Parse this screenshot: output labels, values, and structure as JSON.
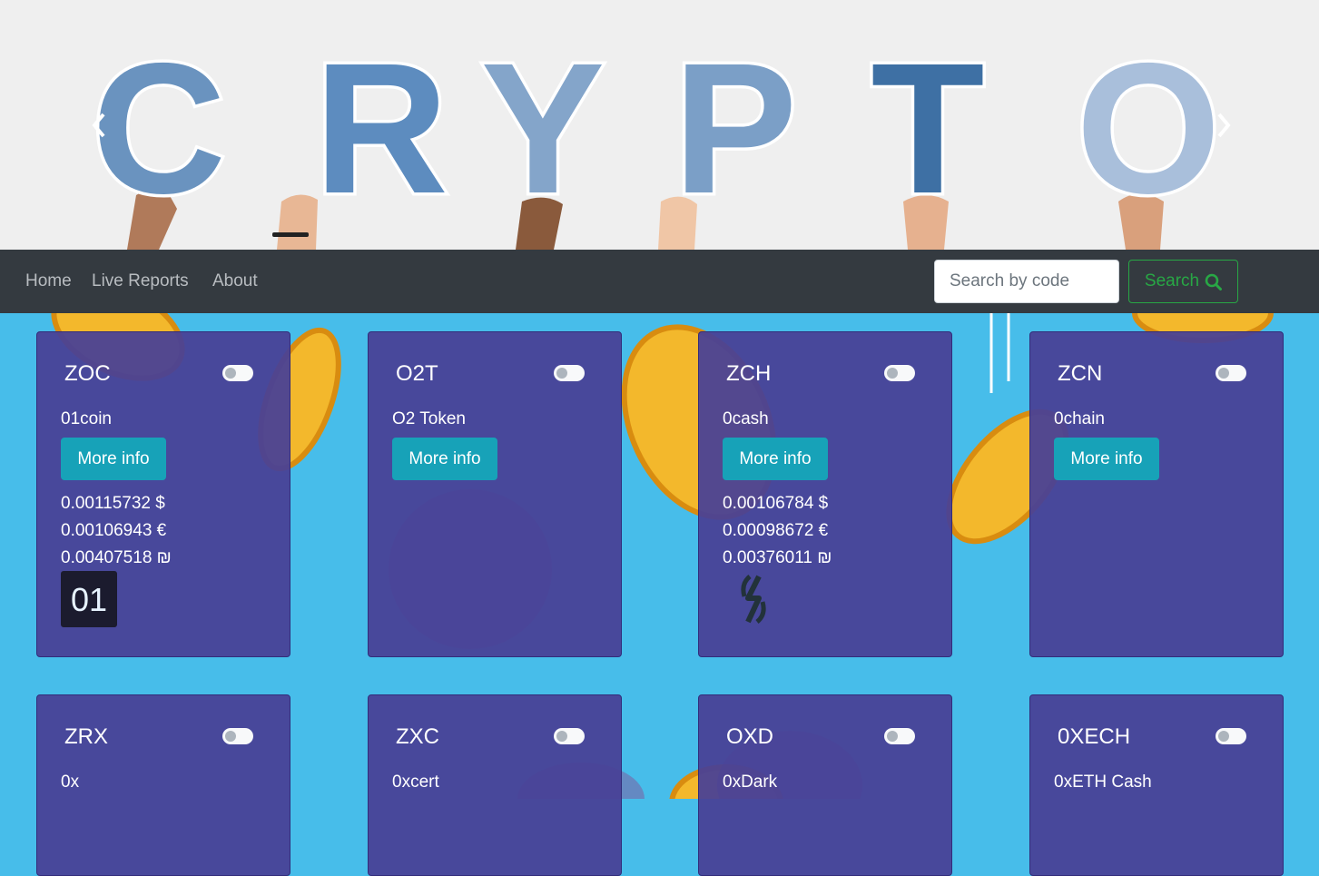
{
  "hero": {
    "word": "CRYPTO",
    "letters": [
      "C",
      "R",
      "Y",
      "P",
      "T",
      "O"
    ],
    "letter_colors": [
      "#6a93bf",
      "#5d8cbf",
      "#84a5ca",
      "#7b9fc7",
      "#3e70a4",
      "#a9bfdb"
    ],
    "prev_icon": "chevron-left-icon",
    "next_icon": "chevron-right-icon"
  },
  "nav": {
    "links": [
      "Home",
      "Live Reports",
      "About"
    ],
    "search_placeholder": "Search by code",
    "search_label": "Search",
    "search_icon": "magnifier-icon"
  },
  "colors": {
    "page_bg": "#47bdea",
    "navbar": "#343a40",
    "card_bg": "#484196",
    "info_button": "#17a2b8",
    "search_button": "#28a745",
    "coin": "#f3b82c"
  },
  "cards": [
    {
      "code": "ZOC",
      "name": "01coin",
      "more": "More info",
      "usd": "0.00115732 $",
      "eur": "0.00106943 €",
      "ils": "0.00407518 ₪",
      "logo": "01coin-logo",
      "logo_text": "01"
    },
    {
      "code": "O2T",
      "name": "O2 Token",
      "more": "More info"
    },
    {
      "code": "ZCH",
      "name": "0cash",
      "more": "More info",
      "usd": "0.00106784 $",
      "eur": "0.00098672 €",
      "ils": "0.00376011 ₪",
      "logo": "0cash-logo"
    },
    {
      "code": "ZCN",
      "name": "0chain",
      "more": "More info"
    },
    {
      "code": "ZRX",
      "name": "0x"
    },
    {
      "code": "ZXC",
      "name": "0xcert"
    },
    {
      "code": "OXD",
      "name": "0xDark"
    },
    {
      "code": "0XECH",
      "name": "0xETH Cash"
    }
  ]
}
